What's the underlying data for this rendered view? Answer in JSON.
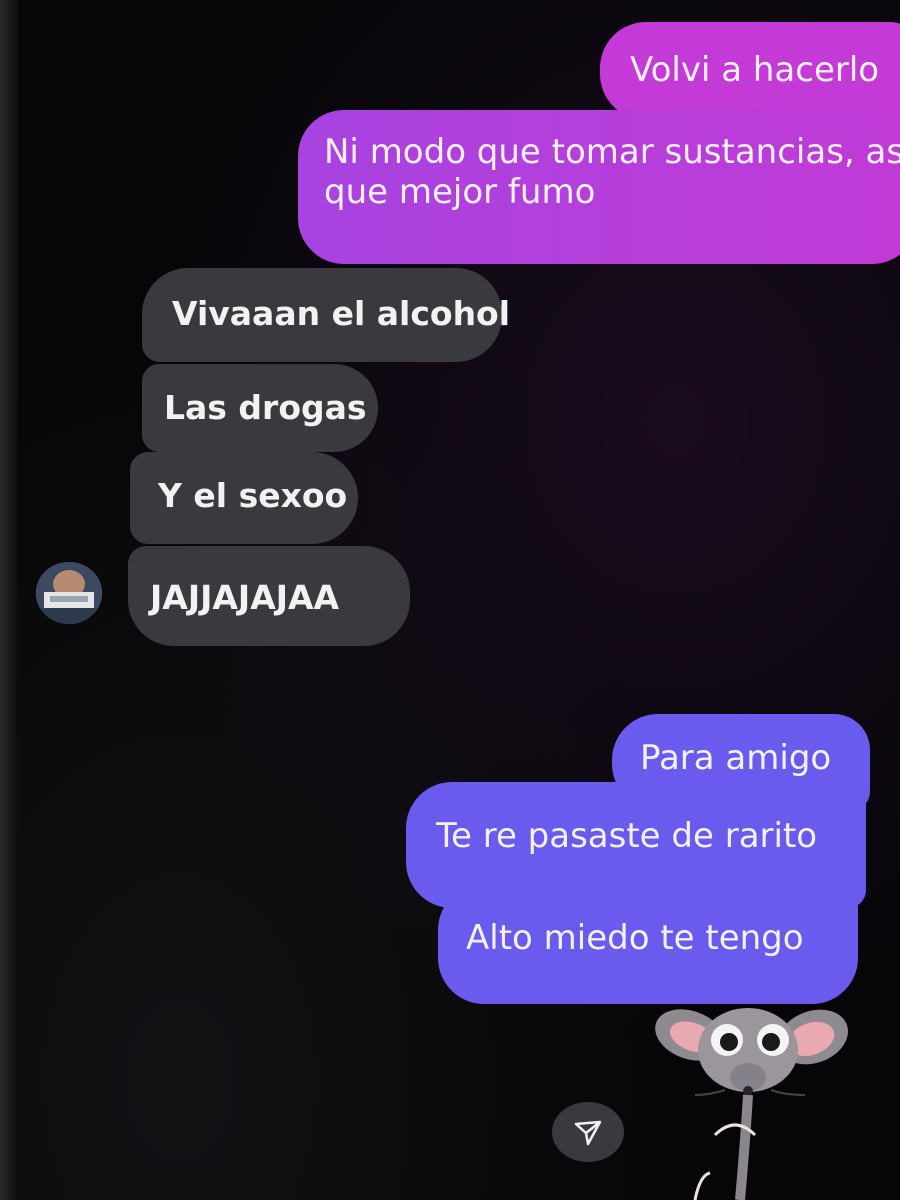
{
  "messages": [
    {
      "id": "b1",
      "direction": "sent",
      "text": "Volvi a hacerlo"
    },
    {
      "id": "b2",
      "direction": "sent",
      "text": "Ni modo que tomar sustancias, así que mejor fumo"
    },
    {
      "id": "r1",
      "direction": "received",
      "text": "Vivaaan el alcohol"
    },
    {
      "id": "r2",
      "direction": "received",
      "text": "Las drogas"
    },
    {
      "id": "r3",
      "direction": "received",
      "text": "Y el sexoo"
    },
    {
      "id": "r4",
      "direction": "received",
      "text": "JAJJAJAJAA"
    },
    {
      "id": "s1",
      "direction": "sent",
      "text": "Para amigo"
    },
    {
      "id": "s2",
      "direction": "sent",
      "text": "Te re pasaste de rarito"
    },
    {
      "id": "s3",
      "direction": "sent",
      "text": "Alto miedo te tengo"
    }
  ],
  "icons": {
    "send": "send-icon",
    "avatar": "contact-avatar",
    "sticker": "mouse-sticker"
  },
  "colors": {
    "sent_top": "#c43ad6",
    "sent_bottom": "#6a5bef",
    "received": "#3a3a3e",
    "background": "#060608"
  }
}
